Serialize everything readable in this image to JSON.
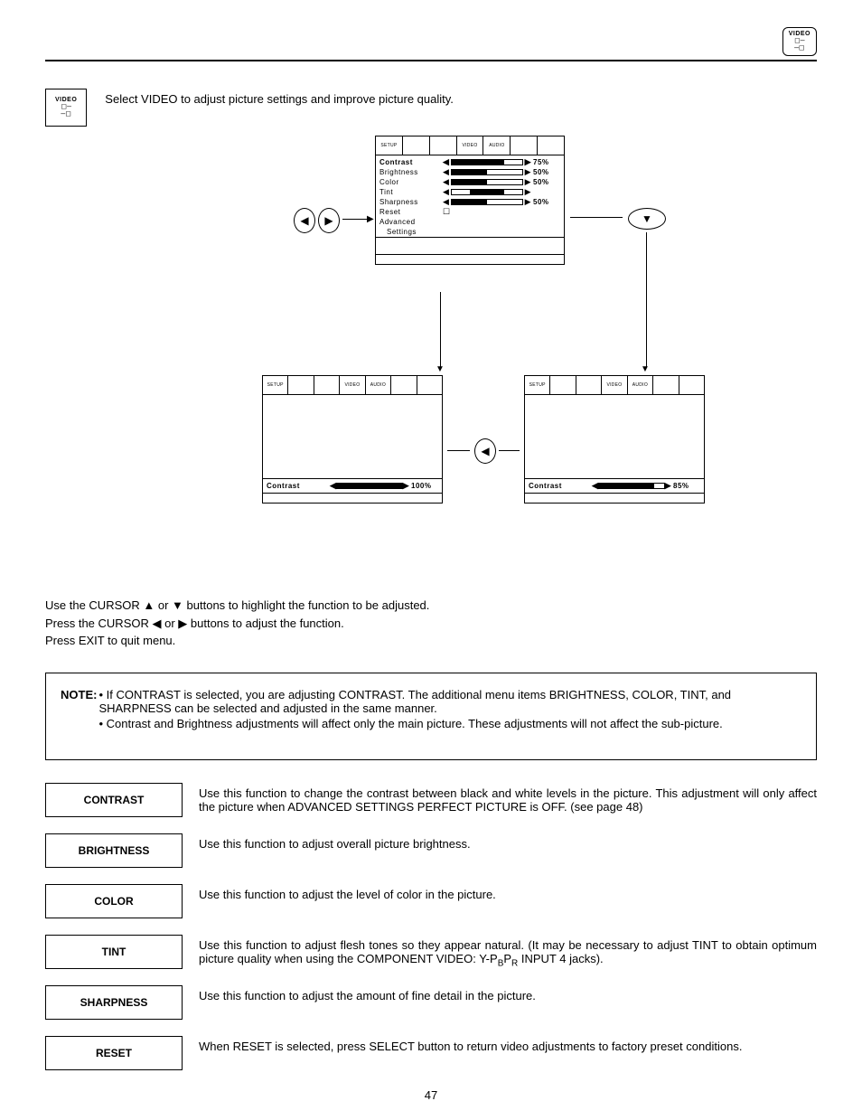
{
  "header_badge": {
    "label": "VIDEO"
  },
  "intro": {
    "icon_label": "VIDEO",
    "text": "Select VIDEO to adjust picture settings and improve picture quality."
  },
  "osd_tabs": [
    "SETUP",
    "",
    "",
    "VIDEO",
    "AUDIO",
    "",
    ""
  ],
  "osd_main_rows": [
    {
      "label": "Contrast",
      "pct": "75%",
      "fill": 75,
      "bold": true
    },
    {
      "label": "Brightness",
      "pct": "50%",
      "fill": 50
    },
    {
      "label": "Color",
      "pct": "50%",
      "fill": 50
    },
    {
      "label": "Tint",
      "pct": "",
      "fill": 50,
      "center": true
    },
    {
      "label": "Sharpness",
      "pct": "50%",
      "fill": 50
    },
    {
      "label": "Reset",
      "checkbox": true
    },
    {
      "label": "Advanced"
    },
    {
      "label": "  Settings",
      "indent": true
    }
  ],
  "osd_left": {
    "label": "Contrast",
    "pct": "100%",
    "fill": 100
  },
  "osd_right": {
    "label": "Contrast",
    "pct": "85%",
    "fill": 85
  },
  "instructions": {
    "l1_pre": "Use the CURSOR ",
    "l1_mid": " or ",
    "l1_post": " buttons to highlight the function to be adjusted.",
    "l2_pre": "Press the CURSOR ",
    "l2_mid": " or ",
    "l2_post": " buttons to adjust the function.",
    "l3": "Press EXIT to quit menu."
  },
  "note": {
    "label": "NOTE:",
    "b1": "• If CONTRAST is selected, you are adjusting CONTRAST.  The additional menu items BRIGHTNESS, COLOR, TINT, and SHARPNESS can be selected and adjusted in the same manner.",
    "b2": "• Contrast and Brightness adjustments will affect only the main picture. These adjustments will not affect the sub-picture."
  },
  "definitions": [
    {
      "label": "CONTRAST",
      "text": "Use this function to change the contrast between black and white levels in the picture.  This adjustment will only affect the picture when ADVANCED SETTINGS PERFECT PICTURE is OFF. (see page 48)"
    },
    {
      "label": "BRIGHTNESS",
      "text": "Use this function to adjust overall picture brightness."
    },
    {
      "label": "COLOR",
      "text": "Use this function to adjust the level of color in the picture."
    },
    {
      "label": "TINT",
      "text": "Use this function to adjust flesh tones so they appear natural. (It may be necessary to adjust TINT to obtain optimum picture quality when using the COMPONENT VIDEO: Y-P<sub>B</sub>P<sub>R</sub> INPUT 4 jacks)."
    },
    {
      "label": "SHARPNESS",
      "text": "Use this function to adjust the amount of fine detail in the picture."
    },
    {
      "label": "RESET",
      "text": "When RESET is selected, press SELECT button to return video adjustments to factory preset conditions."
    }
  ],
  "page_number": "47",
  "symbols": {
    "up": "▲",
    "down": "▼",
    "left": "◀",
    "right": "▶"
  }
}
